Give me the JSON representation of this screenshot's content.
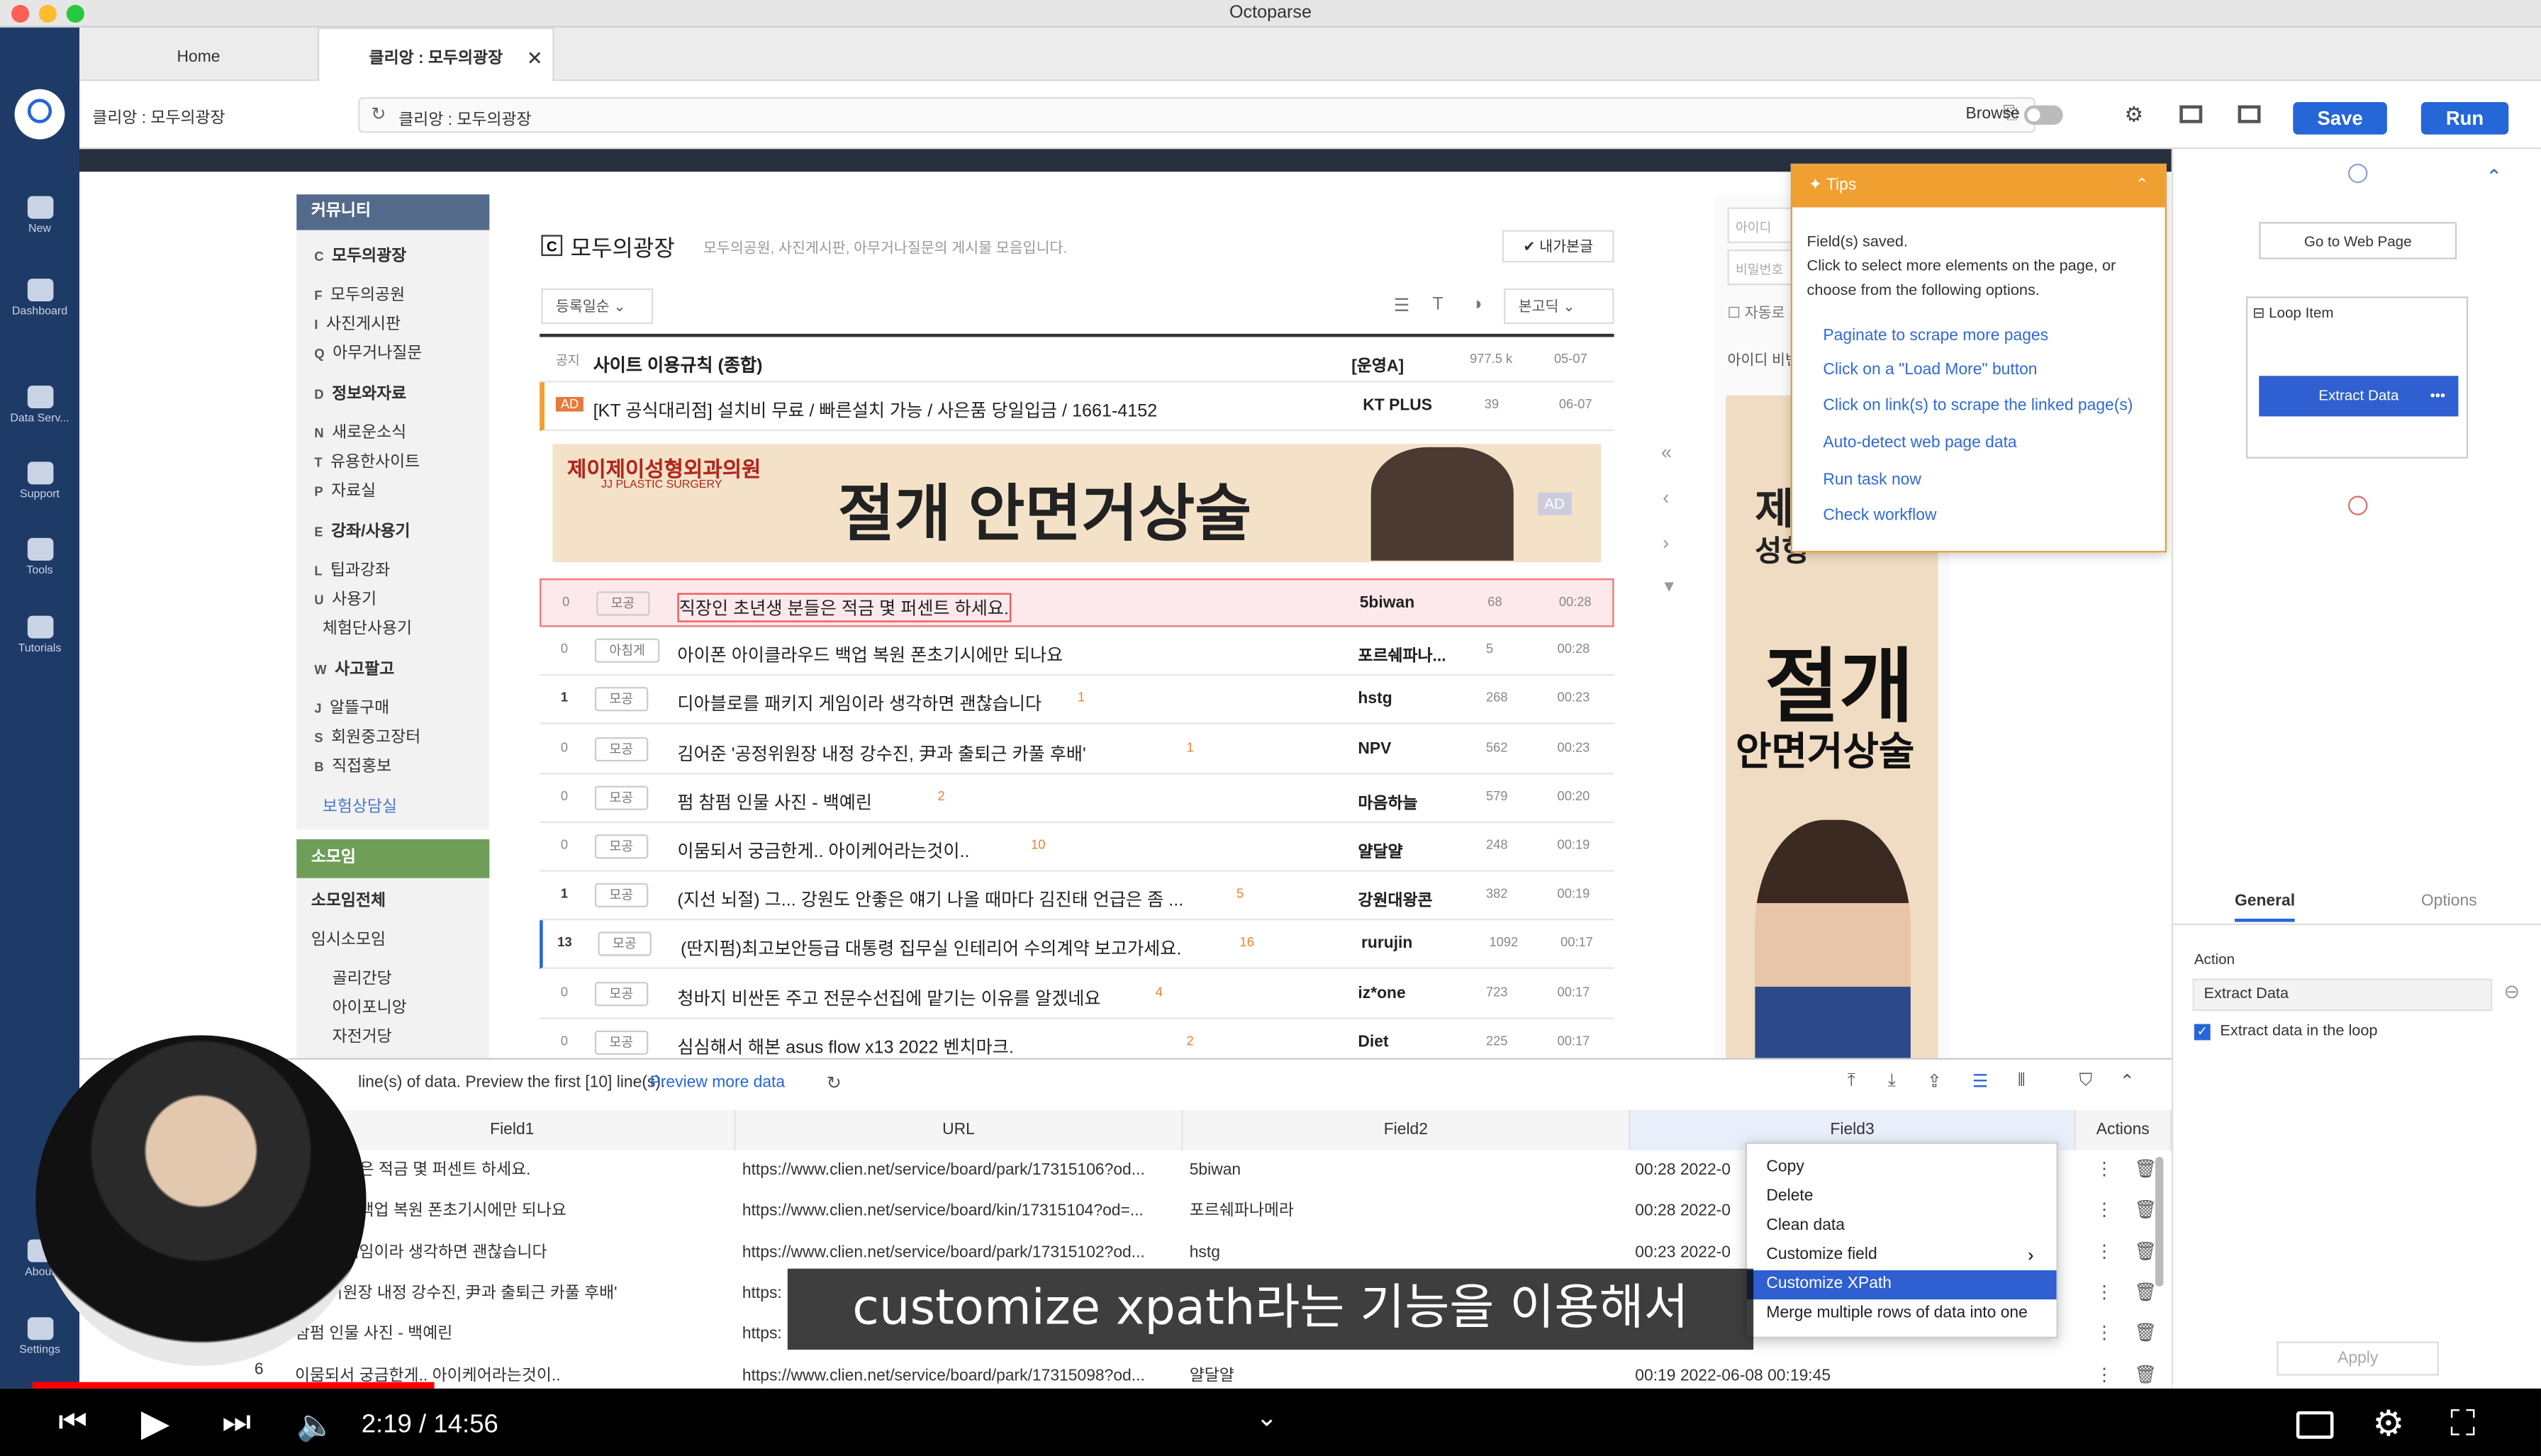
{
  "window_title": "Octoparse",
  "tabs": [
    "Home",
    "클리앙 : 모두의광장"
  ],
  "address": {
    "page_label": "클리앙 : 모두의광장",
    "url_text": "클리앙 : 모두의광장",
    "browse_label": "Browse",
    "save": "Save",
    "run": "Run"
  },
  "sidebar": [
    "New",
    "Dashboard",
    "Data Serv...",
    "Support",
    "Tools",
    "Tutorials",
    "About",
    "Settings"
  ],
  "site_menu": {
    "header": "커뮤니티",
    "items": [
      "모두의광장",
      "모두의공원",
      "사진게시판",
      "아무거나질문",
      "정보와자료",
      "새로운소식",
      "유용한사이트",
      "자료실",
      "강좌/사용기",
      "팁과강좌",
      "사용기",
      "체험단사용기",
      "사고팔고",
      "알뜰구매",
      "회원중고장터",
      "직접홍보",
      "보험상담실"
    ],
    "letters": [
      "C",
      "F",
      "I",
      "Q",
      "D",
      "N",
      "T",
      "P",
      "E",
      "L",
      "U",
      "",
      "W",
      "J",
      "S",
      "B",
      ""
    ],
    "sub_header": "소모임",
    "sub_items": [
      "소모임전체",
      "임시소모임",
      "골리간당",
      "아이포니앙",
      "자전거당"
    ]
  },
  "board": {
    "title": "모두의광장",
    "desc": "모두의공원, 사진게시판, 아무거나질문의 게시물 모음입니다.",
    "my_posts": "내가본글",
    "sort": "등록일순",
    "font": "본고딕",
    "notice": {
      "tag": "공지",
      "title": "사이트 이용규칙 (종합)",
      "author": "[운영A]",
      "views": "977.5 k",
      "time": "05-07"
    },
    "ad_row": {
      "tag": "AD",
      "title": "[KT 공식대리점] 설치비 무료 / 빠른설치 가능 / 사은품 당일입금 / 1661-4152",
      "author": "KT PLUS",
      "views": "39",
      "time": "06-07"
    },
    "banner": {
      "clinic": "제이제이성형외과의원",
      "sub": "JJ PLASTIC SURGERY",
      "headline": "절개 안면거상술",
      "ad": "AD"
    },
    "rows": [
      {
        "n": "0",
        "tag": "모공",
        "title": "직장인 초년생 분들은 적금 몇 퍼센트 하세요.",
        "cnt": "",
        "author": "5biwan",
        "views": "68",
        "time": "00:28"
      },
      {
        "n": "0",
        "tag": "아침게",
        "title": "아이폰 아이클라우드 백업 복원 폰초기시에만 되나요",
        "cnt": "",
        "author": "포르쉐파나...",
        "views": "5",
        "time": "00:28"
      },
      {
        "n": "1",
        "tag": "모공",
        "title": "디아블로를 패키지 게임이라 생각하면 괜찮습니다",
        "cnt": "1",
        "author": "hstg",
        "views": "268",
        "time": "00:23"
      },
      {
        "n": "0",
        "tag": "모공",
        "title": "김어준 '공정위원장 내정 강수진, 尹과 출퇴근 카풀 후배'",
        "cnt": "1",
        "author": "NPV",
        "views": "562",
        "time": "00:23"
      },
      {
        "n": "0",
        "tag": "모공",
        "title": "펌 참펌 인물 사진 - 백예린",
        "cnt": "2",
        "author": "마음하늘",
        "views": "579",
        "time": "00:20"
      },
      {
        "n": "0",
        "tag": "모공",
        "title": "이뭄되서 궁금한게.. 아이케어라는것이..",
        "cnt": "10",
        "author": "얄달얄",
        "views": "248",
        "time": "00:19"
      },
      {
        "n": "1",
        "tag": "모공",
        "title": "(지선 뇌절) 그... 강원도 안좋은 얘기 나올 때마다 김진태 언급은 좀 ...",
        "cnt": "5",
        "author": "강원대왕콘",
        "views": "382",
        "time": "00:19"
      },
      {
        "n": "13",
        "tag": "모공",
        "title": "(딴지펌)최고보안등급 대통령 집무실 인테리어 수의계약 보고가세요.",
        "cnt": "16",
        "author": "rurujin",
        "views": "1092",
        "time": "00:17"
      },
      {
        "n": "0",
        "tag": "모공",
        "title": "청바지 비싼돈 주고 전문수선집에 맡기는 이유를 알겠네요",
        "cnt": "4",
        "author": "iz*one",
        "views": "723",
        "time": "00:17"
      },
      {
        "n": "0",
        "tag": "모공",
        "title": "심심해서 해본 asus flow x13 2022 벤치마크.",
        "cnt": "2",
        "author": "Diet",
        "views": "225",
        "time": "00:17"
      }
    ]
  },
  "login": {
    "id_ph": "아이디",
    "pw_ph": "비밀번호",
    "auto": "자동로",
    "find": "아이디 비번"
  },
  "side_ad": {
    "line1": "제이",
    "line2": "성형",
    "headline1": "절개",
    "headline2": "안면거상술"
  },
  "tips": {
    "title": "Tips",
    "body": "Field(s) saved.\nClick to select more elements on the page, or choose from the following options.",
    "links": [
      "Paginate to scrape more pages",
      "Click on a \"Load More\" button",
      "Click on link(s) to scrape the linked page(s)",
      "Auto-detect web page data",
      "Run task now",
      "Check workflow"
    ]
  },
  "workflow": {
    "go": "Go to Web Page",
    "loop": "Loop Item",
    "extract": "Extract Data",
    "more": "•••"
  },
  "props": {
    "tab_general": "General",
    "tab_options": "Options",
    "action_label": "Action",
    "action_value": "Extract Data",
    "checkbox": "Extract data in the loop",
    "apply": "Apply"
  },
  "preview": {
    "info": "line(s) of data. Preview the first [10] line(s).",
    "more": "Preview more data",
    "columns": [
      "Field1",
      "URL",
      "Field2",
      "Field3",
      "Actions"
    ],
    "rows": [
      {
        "f1": "년생 분들은 적금 몇 퍼센트 하세요.",
        "url": "https://www.clien.net/service/board/park/17315106?od...",
        "f2": "5biwan",
        "f3": "00:28 2022-0"
      },
      {
        "f1": "클라우드 백업 복원 폰초기시에만 되나요",
        "url": "https://www.clien.net/service/board/kin/17315104?od=...",
        "f2": "포르쉐파나메라",
        "f3": "00:28 2022-0"
      },
      {
        "f1": "패키지 게임이라 생각하면 괜찮습니다",
        "url": "https://www.clien.net/service/board/park/17315102?od...",
        "f2": "hstg",
        "f3": "00:23 2022-0"
      },
      {
        "f1": "'공정위원장 내정 강수진, 尹과 출퇴근 카풀 후배'",
        "url": "https:",
        "f2": "",
        "f3": ""
      },
      {
        "f1": "참펌 인물 사진 - 백예린",
        "url": "https:",
        "f2": "",
        "f3": ""
      },
      {
        "f1": "이뭄되서 궁금한게.. 아이케어라는것이..",
        "url": "https://www.clien.net/service/board/park/17315098?od...",
        "f2": "얄달얄",
        "f3": "00:19 2022-06-08 00:19:45"
      }
    ],
    "row6_num": "6"
  },
  "context_menu": [
    "Copy",
    "Delete",
    "Clean data",
    "Customize field",
    "Customize XPath",
    "Merge multiple rows of data into one"
  ],
  "subtitle": "customize xpath라는 기능을 이용해서",
  "video": {
    "time": "2:19 / 14:56",
    "progress": 0.162
  },
  "colors": {
    "sidebar": "#1e3a66",
    "primary": "#2566d9",
    "tips": "#f0a030",
    "highlight": "#2f5fd0"
  }
}
